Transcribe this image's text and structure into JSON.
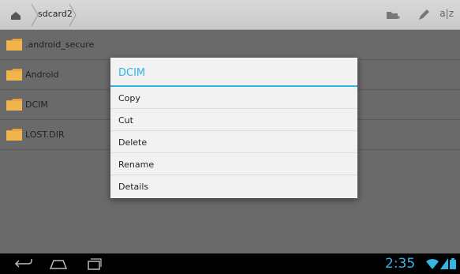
{
  "toolbar": {
    "breadcrumb": "sdcard2",
    "sort_label": "a|z"
  },
  "files": [
    {
      "name": ".android_secure"
    },
    {
      "name": "Android"
    },
    {
      "name": "DCIM"
    },
    {
      "name": "LOST.DIR"
    }
  ],
  "dialog": {
    "title": "DCIM",
    "items": [
      "Copy",
      "Cut",
      "Delete",
      "Rename",
      "Details"
    ]
  },
  "statusbar": {
    "time": "2:35"
  },
  "colors": {
    "accent": "#33b5e5",
    "folder": "#e8a33d"
  }
}
